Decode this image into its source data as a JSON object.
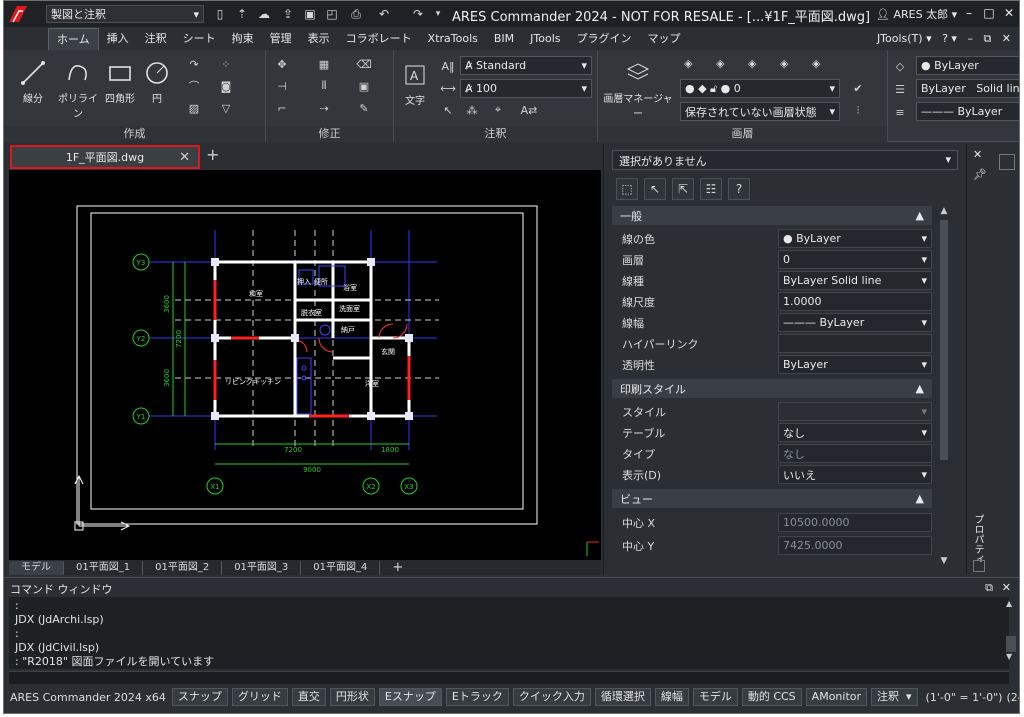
{
  "title_bar": {
    "workspace": "製図と注釈",
    "title": "ARES Commander 2024 - NOT FOR RESALE - [...¥1F_平面図.dwg]",
    "user": "ARES 太郎",
    "brand_color": "#e0171f"
  },
  "menu_tabs": [
    "ホーム",
    "挿入",
    "注釈",
    "シート",
    "拘束",
    "管理",
    "表示",
    "コラボレート",
    "XtraTools",
    "BIM",
    "JTools",
    "プラグイン",
    "マップ"
  ],
  "menu_right": "JTools(T)",
  "ribbon": {
    "draw_labels": [
      "線分",
      "ポリライン",
      "四角形",
      "円"
    ],
    "draw_group": "作成",
    "modify_group": "修正",
    "annot_text": "文字",
    "text_style": "Standard",
    "dim_scale": "100",
    "annot_group": "注釈",
    "layer_manager": "画層マネージャー",
    "layer_current": "0",
    "layer_state": "保存されていない画層状態",
    "layer_group": "画層",
    "prop_color": "ByLayer",
    "prop_linetype": "ByLayer",
    "prop_linetype2": "Solid lin",
    "prop_lineweight": "ByLayer"
  },
  "document_tab": {
    "name": "1F_平面図.dwg"
  },
  "properties": {
    "selection": "選択がありません",
    "sections": {
      "general": {
        "title": "一般",
        "rows": [
          {
            "name": "線の色",
            "value": "● ByLayer"
          },
          {
            "name": "画層",
            "value": "0"
          },
          {
            "name": "線種",
            "value": "ByLayer    Solid line"
          },
          {
            "name": "線尺度",
            "value": "1.0000"
          },
          {
            "name": "線幅",
            "value": "——— ByLayer"
          },
          {
            "name": "ハイパーリンク",
            "value": ""
          },
          {
            "name": "透明性",
            "value": "ByLayer"
          }
        ]
      },
      "plotstyle": {
        "title": "印刷スタイル",
        "rows": [
          {
            "name": "スタイル",
            "value": ""
          },
          {
            "name": "テーブル",
            "value": "なし"
          },
          {
            "name": "タイプ",
            "value": "なし"
          },
          {
            "name": "表示(D)",
            "value": "いいえ"
          }
        ]
      },
      "view": {
        "title": "ビュー",
        "rows": [
          {
            "name": "中心 X",
            "value": "10500.0000"
          },
          {
            "name": "中心 Y",
            "value": "7425.0000"
          }
        ]
      }
    },
    "side_label": "プロパティ"
  },
  "layout_tabs": [
    "モデル",
    "01平面図_1",
    "01平面図_2",
    "01平面図_3",
    "01平面図_4"
  ],
  "drawing": {
    "grid_y": [
      "Y3",
      "Y2",
      "Y1"
    ],
    "grid_x": [
      "X1",
      "X2",
      "X3"
    ],
    "dims_left": [
      "3600",
      "7200",
      "3600"
    ],
    "dim_bottom_1": "7200",
    "dim_bottom_2": "1800",
    "dim_total": "9000",
    "rooms": {
      "washitsu": "和室",
      "oshiire": "押入",
      "benjo": "便所",
      "yokushitsu": "浴室",
      "datsui": "脱衣室",
      "senmen": "洗面室",
      "nando": "納戸",
      "genkan": "玄関",
      "ldk": "リビングキッチン",
      "youshitsu": "洋室"
    }
  },
  "command_window": {
    "title": "コマンド ウィンドウ",
    "lines": [
      ":",
      "JDX (JdArchi.lsp)",
      ":",
      "JDX (JdCivil.lsp)",
      ": \"R2018\" 図面ファイルを開いています"
    ]
  },
  "status_bar": {
    "app": "ARES Commander 2024 x64",
    "buttons": [
      "スナップ",
      "グリッド",
      "直交",
      "円形状",
      "Eスナップ",
      "Eトラック",
      "クイック入力",
      "循環選択",
      "線幅",
      "モデル",
      "動的 CCS",
      "AMonitor"
    ],
    "annot": "注釈",
    "scale": "(1'-0\" = 1'-0\")",
    "coords": "(24117.4419,-1524.7643,0.0"
  }
}
